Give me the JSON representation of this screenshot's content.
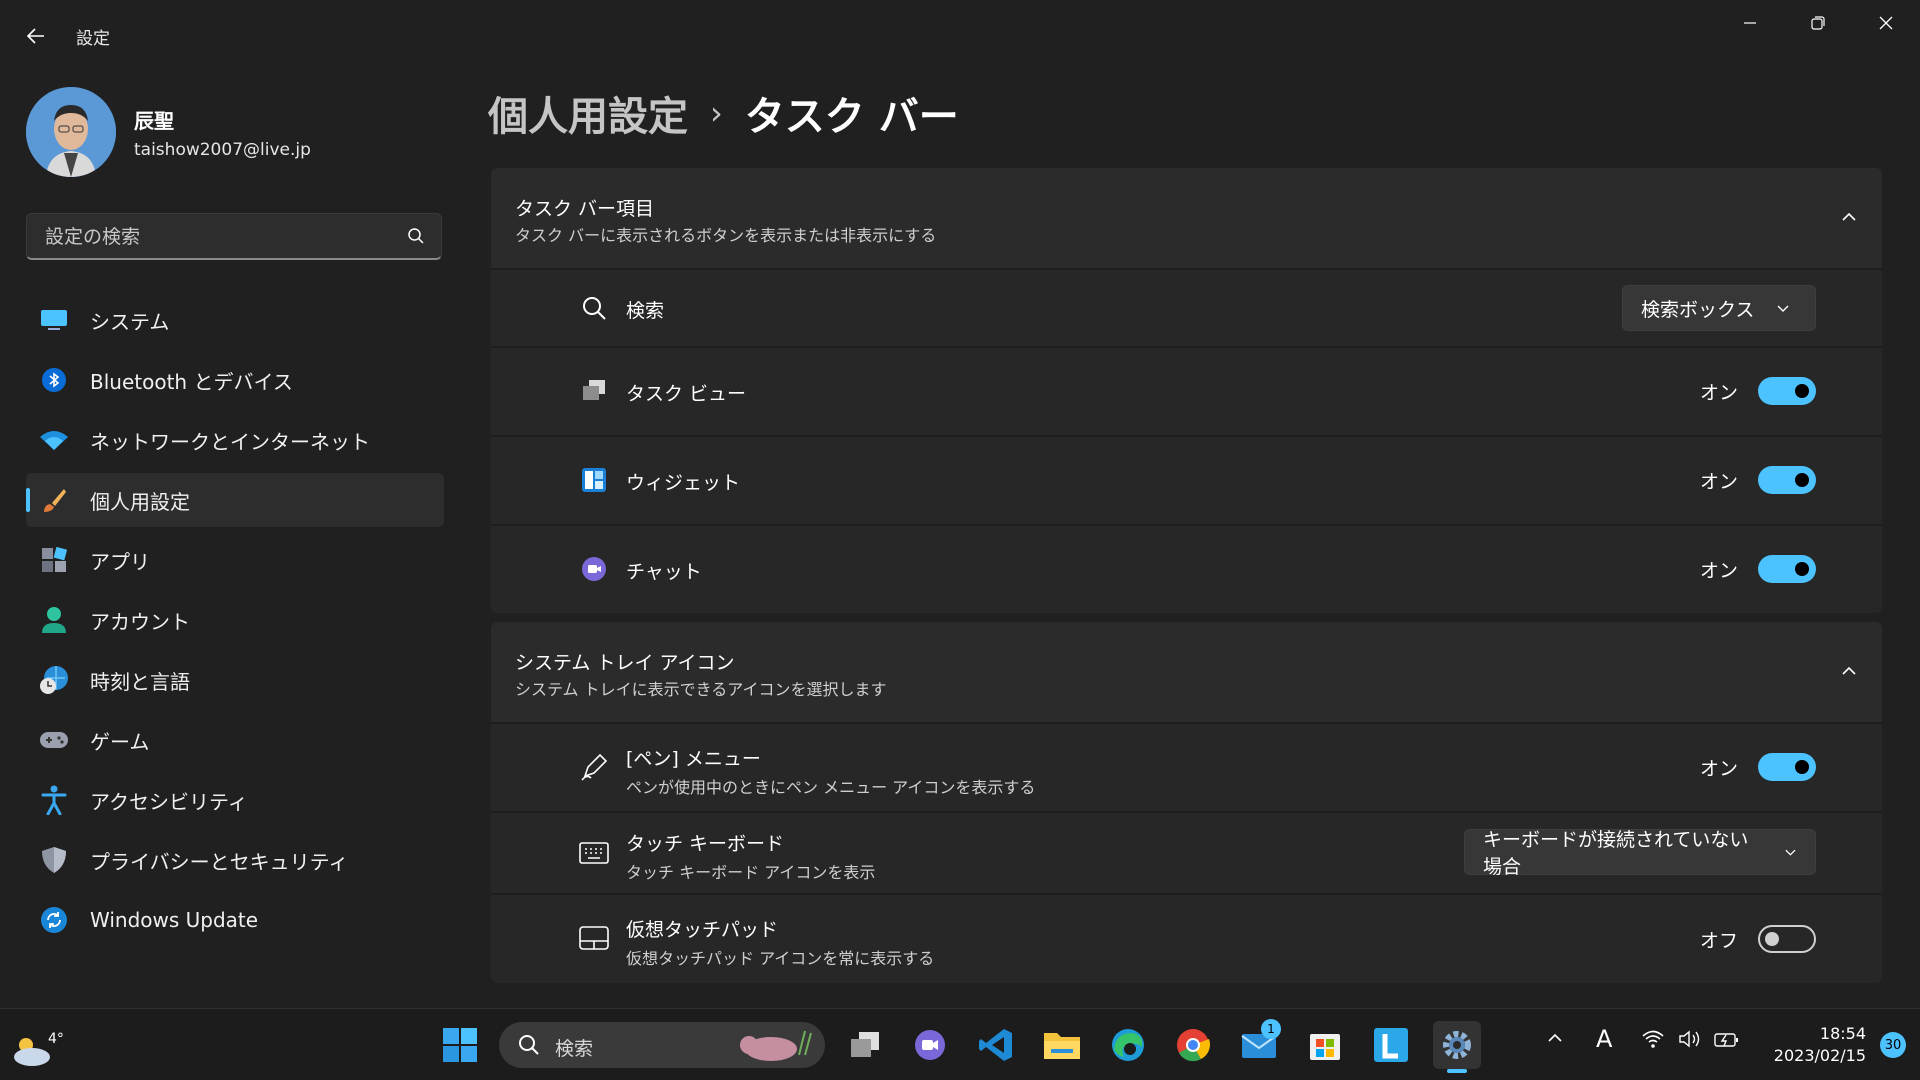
{
  "window": {
    "title": "設定",
    "minimize_label": "最小化",
    "restore_label": "元に戻す",
    "close_label": "閉じる"
  },
  "profile": {
    "name": "辰聖",
    "email": "taishow2007@live.jp"
  },
  "search": {
    "placeholder": "設定の検索"
  },
  "sidebar": {
    "items": [
      {
        "label": "システム",
        "icon": "monitor-icon"
      },
      {
        "label": "Bluetooth とデバイス",
        "icon": "bluetooth-icon"
      },
      {
        "label": "ネットワークとインターネット",
        "icon": "wifi-icon"
      },
      {
        "label": "個人用設定",
        "icon": "brush-icon",
        "active": true
      },
      {
        "label": "アプリ",
        "icon": "apps-icon"
      },
      {
        "label": "アカウント",
        "icon": "person-icon"
      },
      {
        "label": "時刻と言語",
        "icon": "globe-clock-icon"
      },
      {
        "label": "ゲーム",
        "icon": "gamepad-icon"
      },
      {
        "label": "アクセシビリティ",
        "icon": "accessibility-icon"
      },
      {
        "label": "プライバシーとセキュリティ",
        "icon": "shield-icon"
      },
      {
        "label": "Windows Update",
        "icon": "update-icon"
      }
    ]
  },
  "breadcrumb": {
    "parent": "個人用設定",
    "separator": "›",
    "current": "タスク バー"
  },
  "taskbar_items_section": {
    "title": "タスク バー項目",
    "description": "タスク バーに表示されるボタンを表示または非表示にする",
    "rows": [
      {
        "label": "検索",
        "control": "dropdown",
        "value": "検索ボックス"
      },
      {
        "label": "タスク ビュー",
        "control": "toggle",
        "state": "オン",
        "on": true
      },
      {
        "label": "ウィジェット",
        "control": "toggle",
        "state": "オン",
        "on": true
      },
      {
        "label": "チャット",
        "control": "toggle",
        "state": "オン",
        "on": true
      }
    ]
  },
  "tray_section": {
    "title": "システム トレイ アイコン",
    "description": "システム トレイに表示できるアイコンを選択します",
    "rows": [
      {
        "label": "[ペン] メニュー",
        "sub": "ペンが使用中のときにペン メニュー アイコンを表示する",
        "control": "toggle",
        "state": "オン",
        "on": true
      },
      {
        "label": "タッチ キーボード",
        "sub": "タッチ キーボード アイコンを表示",
        "control": "dropdown",
        "value": "キーボードが接続されていない場合"
      },
      {
        "label": "仮想タッチパッド",
        "sub": "仮想タッチパッド アイコンを常に表示する",
        "control": "toggle",
        "state": "オフ",
        "on": false
      }
    ]
  },
  "taskbar": {
    "weather_temp": "4°",
    "search_text": "検索",
    "mail_badge": "1",
    "ime": "A",
    "time": "18:54",
    "date": "2023/02/15",
    "notification_count": "30"
  },
  "colors": {
    "accent": "#4cc2ff",
    "background": "#202020",
    "card": "#2b2b2b"
  }
}
